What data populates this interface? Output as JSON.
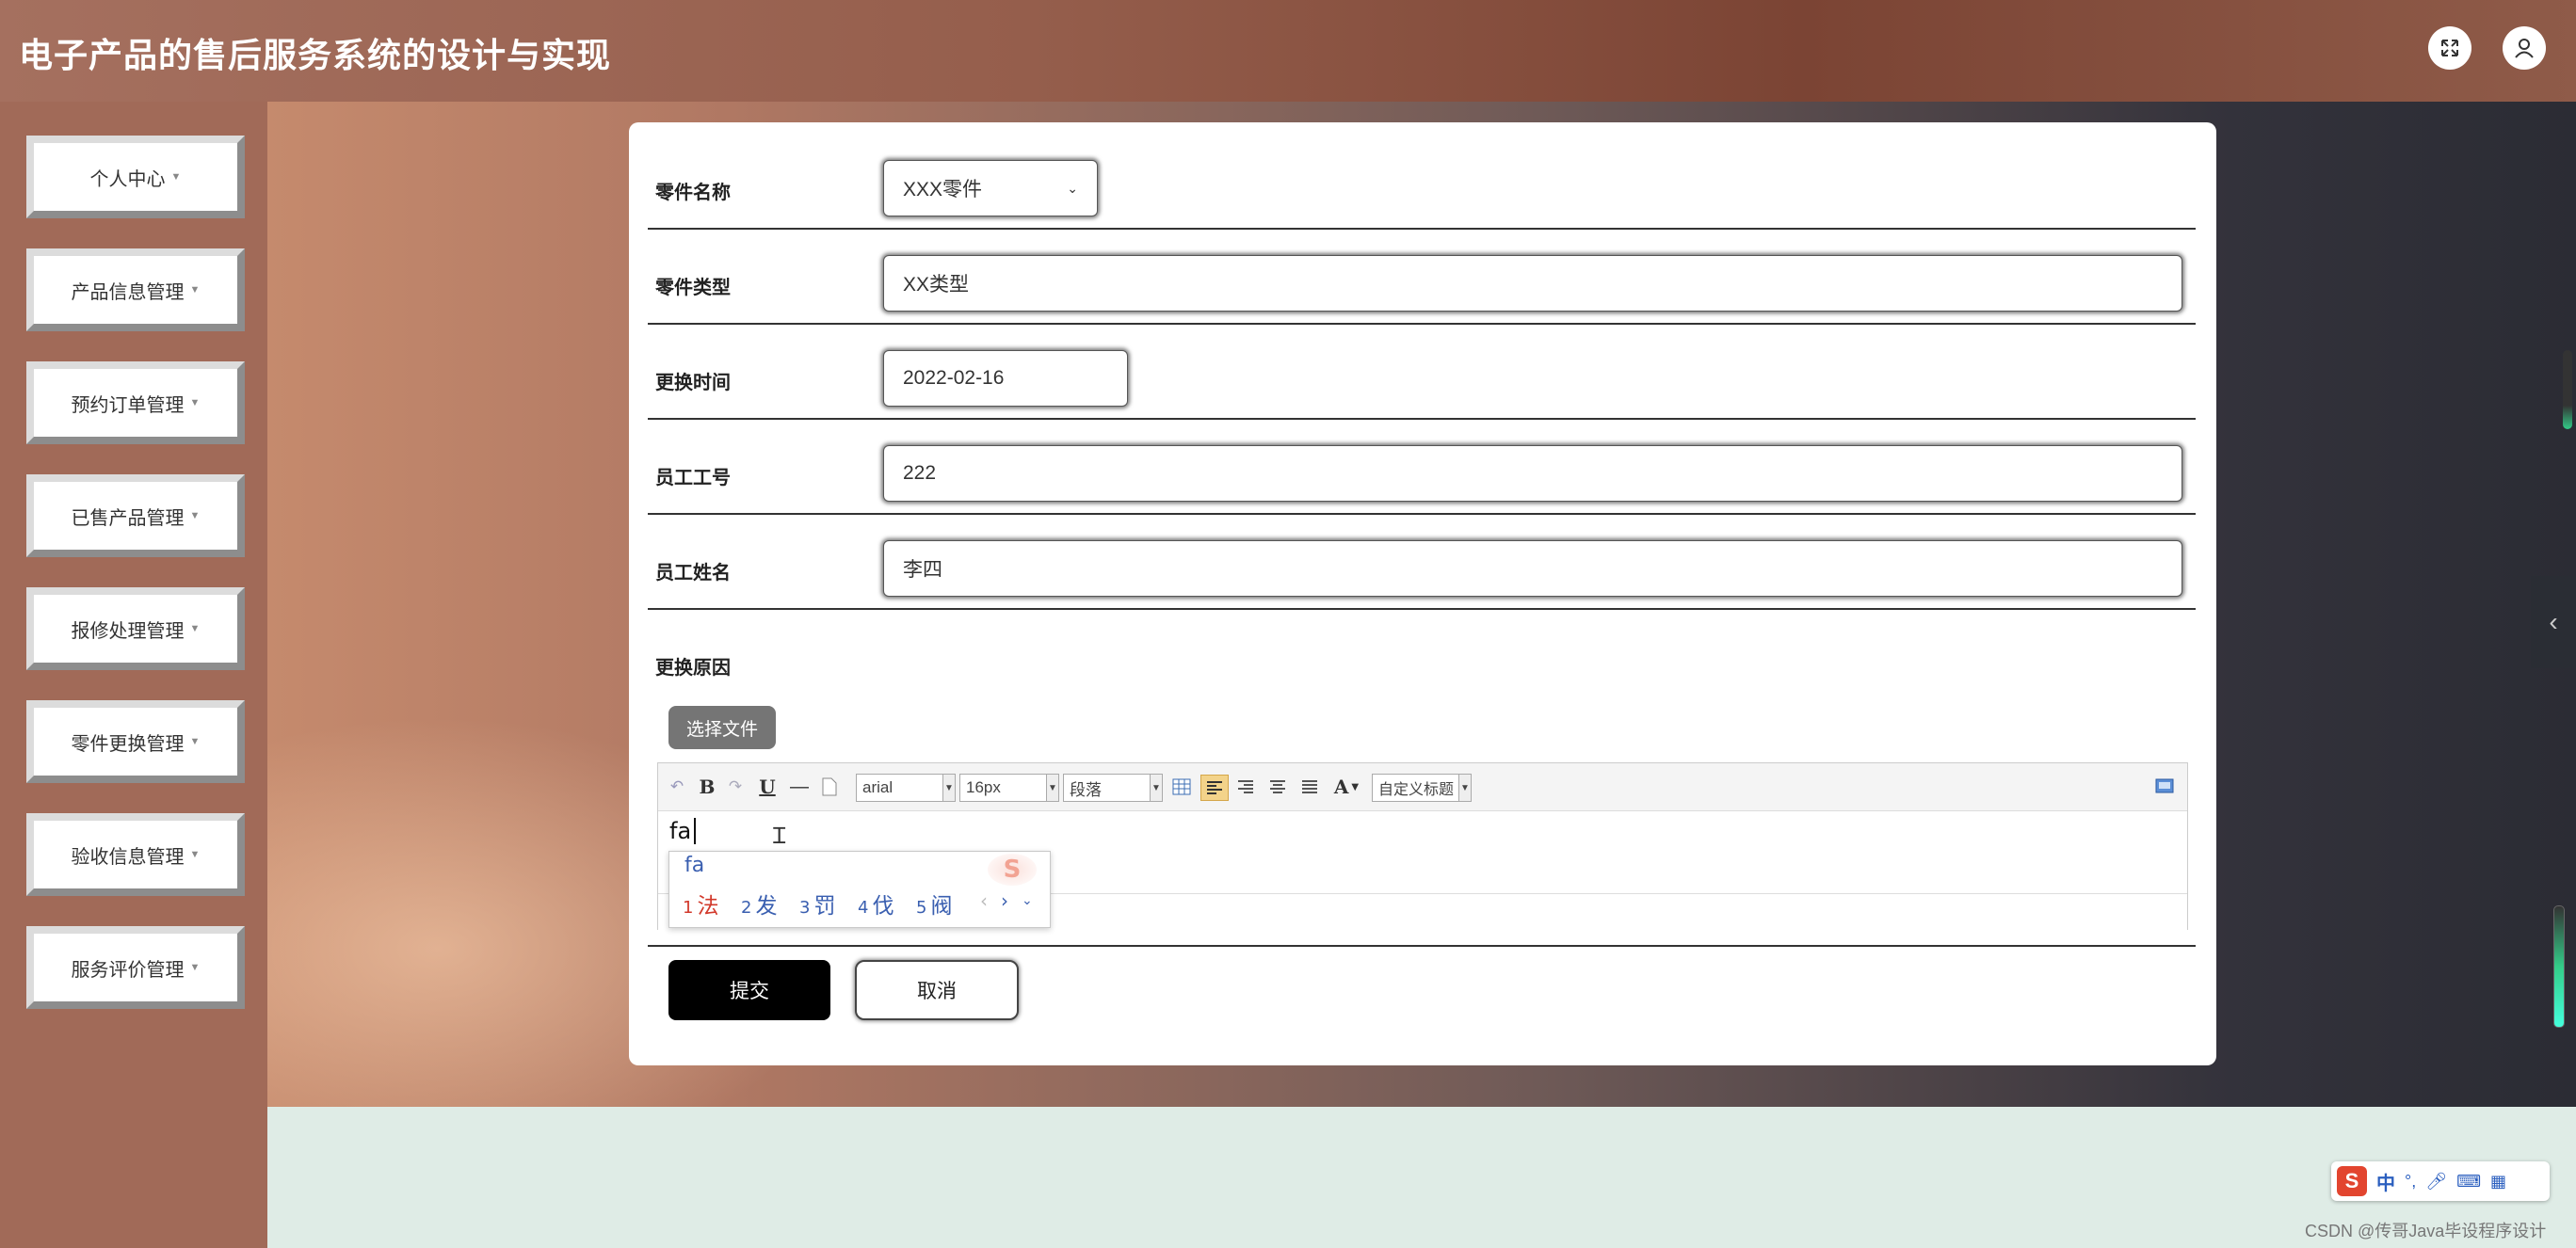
{
  "app": {
    "title": "电子产品的售后服务系统的设计与实现"
  },
  "header_icons": [
    "fullscreen-icon",
    "user-icon"
  ],
  "sidebar": {
    "items": [
      {
        "label": "个人中心"
      },
      {
        "label": "产品信息管理"
      },
      {
        "label": "预约订单管理"
      },
      {
        "label": "已售产品管理"
      },
      {
        "label": "报修处理管理"
      },
      {
        "label": "零件更换管理"
      },
      {
        "label": "验收信息管理"
      },
      {
        "label": "服务评价管理"
      }
    ]
  },
  "form": {
    "part_name": {
      "label": "零件名称",
      "value": "XXX零件"
    },
    "part_type": {
      "label": "零件类型",
      "value": "XX类型"
    },
    "replace_time": {
      "label": "更换时间",
      "value": "2022-02-16"
    },
    "employee_no": {
      "label": "员工工号",
      "value": "222"
    },
    "employee_name": {
      "label": "员工姓名",
      "value": "李四"
    },
    "reason": {
      "label": "更换原因"
    },
    "upload_label": "选择文件",
    "submit_label": "提交",
    "cancel_label": "取消"
  },
  "editor": {
    "font_family": "arial",
    "font_size": "16px",
    "paragraph": "段落",
    "custom_title": "自定义标题",
    "content": "fa"
  },
  "ime": {
    "composition": "fa",
    "candidates": [
      {
        "n": "1",
        "text": "法"
      },
      {
        "n": "2",
        "text": "发"
      },
      {
        "n": "3",
        "text": "罚"
      },
      {
        "n": "4",
        "text": "伐"
      },
      {
        "n": "5",
        "text": "阀"
      }
    ],
    "bar_label": "中"
  },
  "watermark": "CSDN @传哥Java毕设程序设计",
  "colors": {
    "submit_bg": "#000000",
    "topbar": "#955e4c",
    "sidebar": "#a16a58"
  }
}
